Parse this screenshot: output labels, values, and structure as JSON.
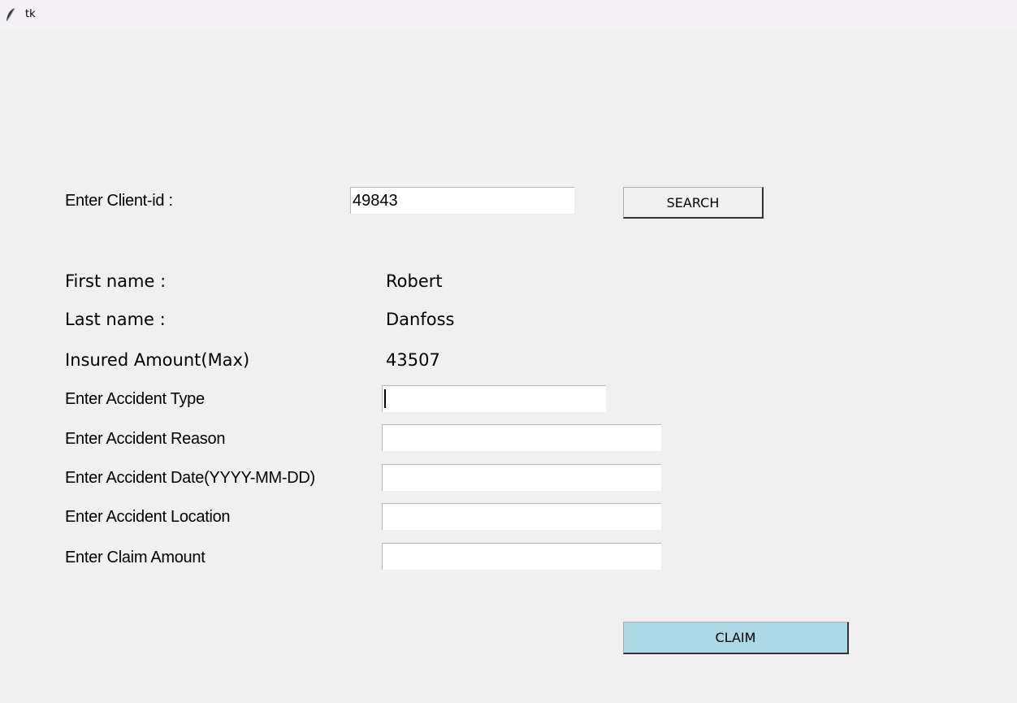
{
  "window": {
    "title": "tk",
    "icon": "feather-icon"
  },
  "search": {
    "label": "Enter Client-id :",
    "value": "49843",
    "button_label": "SEARCH"
  },
  "client": {
    "first_name_label": "First name :",
    "first_name_value": "Robert",
    "last_name_label": "Last name :",
    "last_name_value": "Danfoss",
    "insured_label": "Insured Amount(Max)",
    "insured_value": "43507"
  },
  "claim_form": {
    "accident_type_label": "Enter Accident Type",
    "accident_type_value": "",
    "accident_reason_label": "Enter Accident Reason",
    "accident_reason_value": "",
    "accident_date_label": "Enter Accident Date(YYYY-MM-DD)",
    "accident_date_value": "",
    "accident_location_label": "Enter Accident Location",
    "accident_location_value": "",
    "claim_amount_label": "Enter Claim Amount",
    "claim_amount_value": "",
    "claim_button_label": "CLAIM"
  },
  "colors": {
    "window_background": "#f0f0f0",
    "titlebar_background": "#f3f1f5",
    "claim_button_background": "#add8e6",
    "entry_background": "#ffffff"
  }
}
